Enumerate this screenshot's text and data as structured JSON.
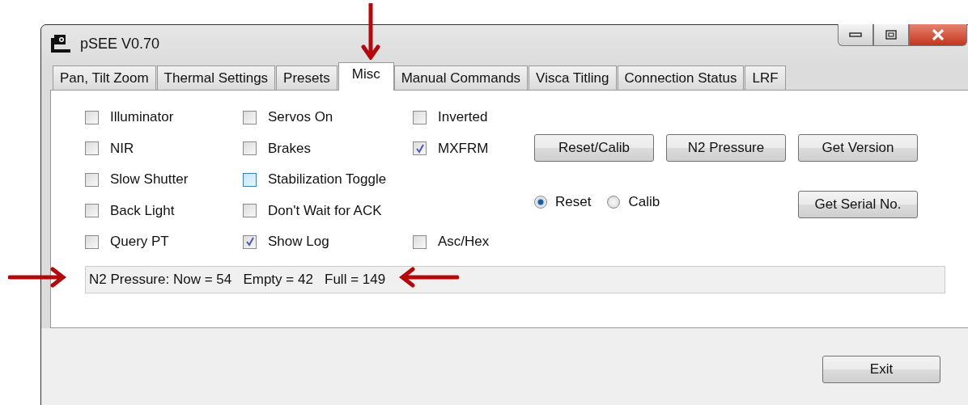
{
  "window": {
    "title": "pSEE V0.70"
  },
  "tabs": [
    {
      "label": "Pan, Tilt  Zoom",
      "selected": false
    },
    {
      "label": "Thermal Settings",
      "selected": false
    },
    {
      "label": "Presets",
      "selected": false
    },
    {
      "label": "Misc",
      "selected": true
    },
    {
      "label": "Manual Commands",
      "selected": false
    },
    {
      "label": "Visca Titling",
      "selected": false
    },
    {
      "label": "Connection Status",
      "selected": false
    },
    {
      "label": "LRF",
      "selected": false
    }
  ],
  "checkbox_columns": [
    [
      {
        "label": "Illuminator",
        "checked": false,
        "highlighted": false
      },
      {
        "label": "NIR",
        "checked": false,
        "highlighted": false
      },
      {
        "label": "Slow Shutter",
        "checked": false,
        "highlighted": false
      },
      {
        "label": "Back Light",
        "checked": false,
        "highlighted": false
      },
      {
        "label": "Query PT",
        "checked": false,
        "highlighted": false
      }
    ],
    [
      {
        "label": "Servos On",
        "checked": false,
        "highlighted": false
      },
      {
        "label": "Brakes",
        "checked": false,
        "highlighted": false
      },
      {
        "label": "Stabilization Toggle",
        "checked": false,
        "highlighted": true
      },
      {
        "label": "Don't Wait for ACK",
        "checked": false,
        "highlighted": false
      },
      {
        "label": "Show Log",
        "checked": true,
        "highlighted": false
      }
    ],
    [
      {
        "label": "Inverted",
        "checked": false,
        "highlighted": false
      },
      {
        "label": "MXFRM",
        "checked": true,
        "highlighted": false
      },
      null,
      null,
      {
        "label": "Asc/Hex",
        "checked": false,
        "highlighted": false
      }
    ]
  ],
  "buttons": [
    "Reset/Calib",
    "N2 Pressure",
    "Get Version"
  ],
  "radios": [
    {
      "label": "Reset",
      "selected": true
    },
    {
      "label": "Calib",
      "selected": false
    }
  ],
  "serial_button": "Get Serial No.",
  "status": "N2 Pressure: Now = 54   Empty = 42   Full = 149",
  "exit_button": "Exit"
}
